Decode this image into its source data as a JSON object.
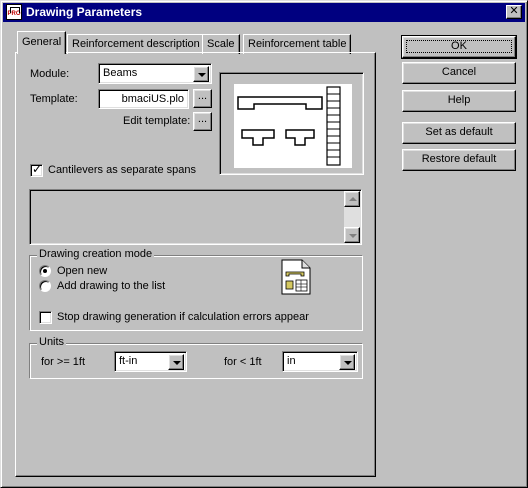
{
  "window": {
    "title": "Drawing Parameters",
    "app_icon_text": "PRO"
  },
  "tabs": [
    {
      "label": "General"
    },
    {
      "label": "Reinforcement description"
    },
    {
      "label": "Scale"
    },
    {
      "label": "Reinforcement table"
    }
  ],
  "general": {
    "module_label": "Module:",
    "module_value": "Beams",
    "template_label": "Template:",
    "template_value": "bmaciUS.plo",
    "browse_label": "...",
    "edit_template_label": "Edit template:",
    "edit_button_label": "...",
    "cantilevers_label": "Cantilevers as separate spans",
    "cantilevers_checked": true
  },
  "drawing_mode": {
    "title": "Drawing creation mode",
    "open_new": "Open new",
    "add_to_list": "Add drawing to the list",
    "selected": "open_new",
    "stop_label": "Stop drawing generation if calculation errors appear",
    "stop_checked": false
  },
  "units": {
    "title": "Units",
    "ge_label": "for >= 1ft",
    "ge_value": "ft-in",
    "lt_label": "for < 1ft",
    "lt_value": "in"
  },
  "buttons": {
    "ok": "OK",
    "cancel": "Cancel",
    "help": "Help",
    "set_default": "Set as default",
    "restore_default": "Restore default"
  }
}
